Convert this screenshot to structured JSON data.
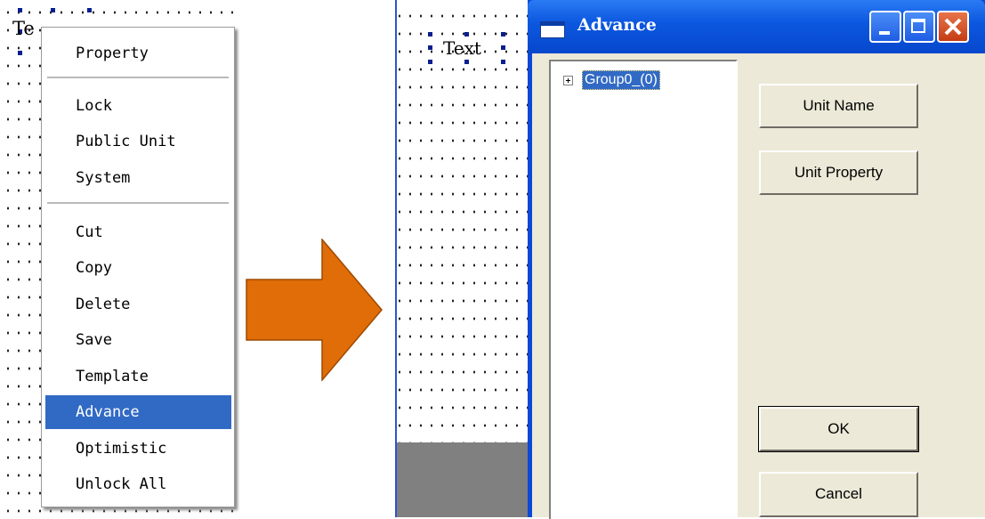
{
  "left": {
    "text_label": "Te",
    "context_menu": {
      "items": [
        {
          "label": "Property"
        },
        {
          "label": "Lock"
        },
        {
          "label": "Public Unit"
        },
        {
          "label": "System"
        },
        {
          "label": "Cut"
        },
        {
          "label": "Copy"
        },
        {
          "label": "Delete"
        },
        {
          "label": "Save"
        },
        {
          "label": "Template"
        },
        {
          "label": "Advance",
          "selected": true
        },
        {
          "label": "Optimistic"
        },
        {
          "label": "Unlock All"
        }
      ]
    }
  },
  "arrow": {
    "color": "#e06d08"
  },
  "right": {
    "text_label": "Text",
    "dialog": {
      "title": "Advance",
      "tree": {
        "items": [
          {
            "label": "Group0_(0)",
            "selected": true,
            "expander": "plus-box-icon"
          }
        ]
      },
      "buttons": {
        "unit_name": "Unit Name",
        "unit_property": "Unit Property",
        "ok": "OK",
        "cancel": "Cancel"
      },
      "title_buttons": [
        "minimize-icon",
        "maximize-icon",
        "close-icon"
      ]
    }
  },
  "colors": {
    "selection": "#316ac5",
    "titlebar": "#0a49d6",
    "dialog_face": "#ece9d8"
  }
}
